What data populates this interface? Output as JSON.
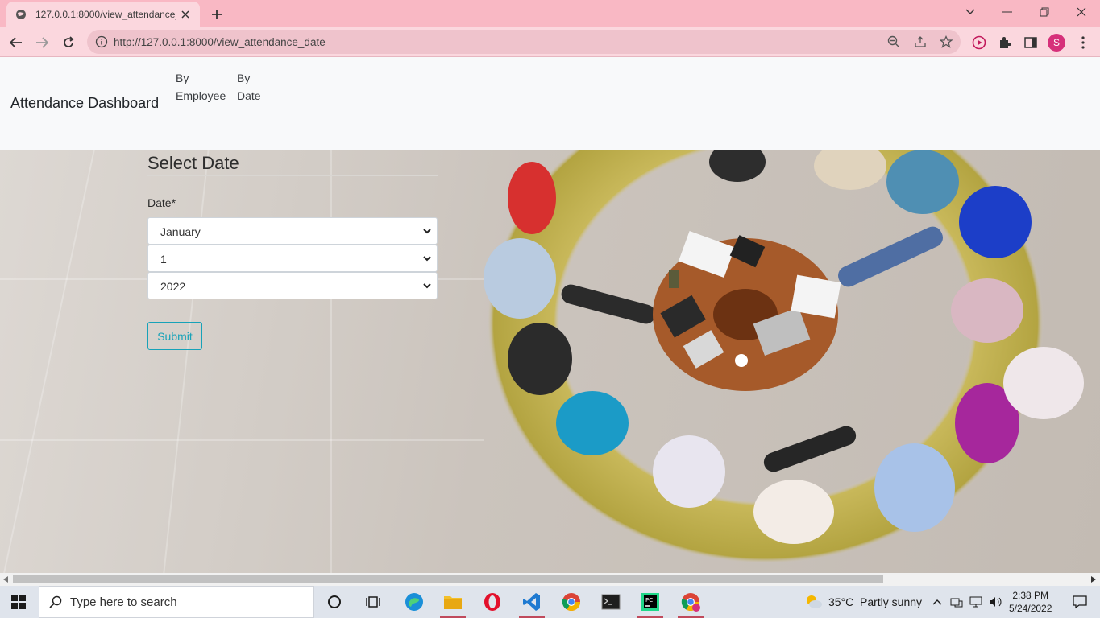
{
  "browser": {
    "tab_title": "127.0.0.1:8000/view_attendance_",
    "url": "http://127.0.0.1:8000/view_attendance_date",
    "profile_initial": "S",
    "accent_color": "#f9b8c4"
  },
  "navbar": {
    "brand": "Attendance Dashboard",
    "links": [
      {
        "line1": "By",
        "line2": "Employee"
      },
      {
        "line1": "By",
        "line2": "Date"
      }
    ]
  },
  "form": {
    "title": "Select Date",
    "label": "Date*",
    "month_value": "January",
    "day_value": "1",
    "year_value": "2022",
    "submit_label": "Submit",
    "button_color": "#17a2b8"
  },
  "taskbar": {
    "search_placeholder": "Type here to search",
    "weather_temp": "35°C",
    "weather_desc": "Partly sunny",
    "time": "2:38 PM",
    "date": "5/24/2022"
  }
}
